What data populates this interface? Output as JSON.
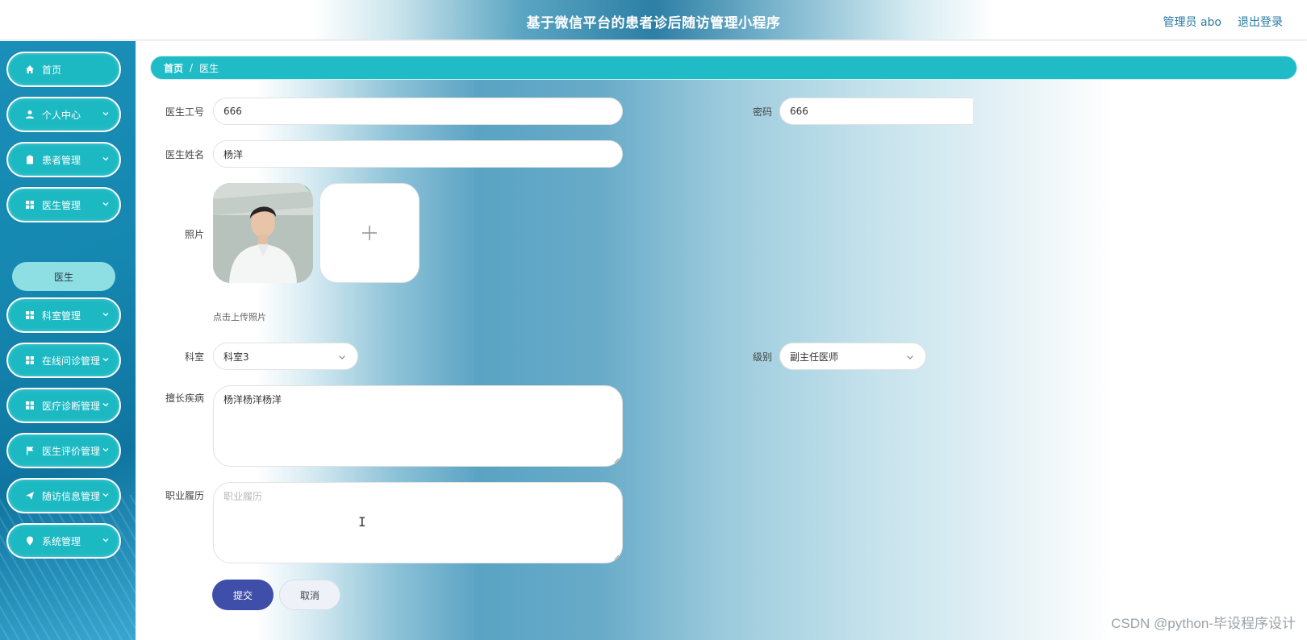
{
  "header": {
    "title": "基于微信平台的患者诊后随访管理小程序",
    "user_label": "管理员 abo",
    "logout_label": "退出登录"
  },
  "sidebar": {
    "items": [
      {
        "label": "首页",
        "icon": "home-icon",
        "has_chevron": false
      },
      {
        "label": "个人中心",
        "icon": "user-icon",
        "has_chevron": true
      },
      {
        "label": "患者管理",
        "icon": "clipboard-icon",
        "has_chevron": true
      },
      {
        "label": "医生管理",
        "icon": "grid-icon",
        "has_chevron": true
      },
      {
        "label": "科室管理",
        "icon": "grid-icon",
        "has_chevron": true
      },
      {
        "label": "在线问诊管理",
        "icon": "grid-icon",
        "has_chevron": true
      },
      {
        "label": "医疗诊断管理",
        "icon": "grid-icon",
        "has_chevron": true
      },
      {
        "label": "医生评价管理",
        "icon": "flag-icon",
        "has_chevron": true
      },
      {
        "label": "随访信息管理",
        "icon": "send-icon",
        "has_chevron": true
      },
      {
        "label": "系统管理",
        "icon": "location-icon",
        "has_chevron": true
      }
    ],
    "submenu": {
      "label": "医生"
    }
  },
  "breadcrumb": {
    "home": "首页",
    "separator": "/",
    "current": "医生"
  },
  "form": {
    "doctor_id": {
      "label": "医生工号",
      "value": "666"
    },
    "password": {
      "label": "密码",
      "value": "666"
    },
    "doctor_name": {
      "label": "医生姓名",
      "value": "杨洋"
    },
    "photo": {
      "label": "照片",
      "upload_tip": "点击上传照片"
    },
    "department": {
      "label": "科室",
      "value": "科室3"
    },
    "level": {
      "label": "级别",
      "value": "副主任医师"
    },
    "specialty": {
      "label": "擅长疾病",
      "value": "杨洋杨洋杨洋"
    },
    "resume": {
      "label": "职业履历",
      "placeholder": "职业履历"
    },
    "submit_label": "提交",
    "cancel_label": "取消"
  },
  "watermark": "CSDN @python-毕设程序设计",
  "colors": {
    "accent": "#1fbcc7",
    "submit": "#3f4ea8",
    "sidebar": "#1587b0"
  }
}
